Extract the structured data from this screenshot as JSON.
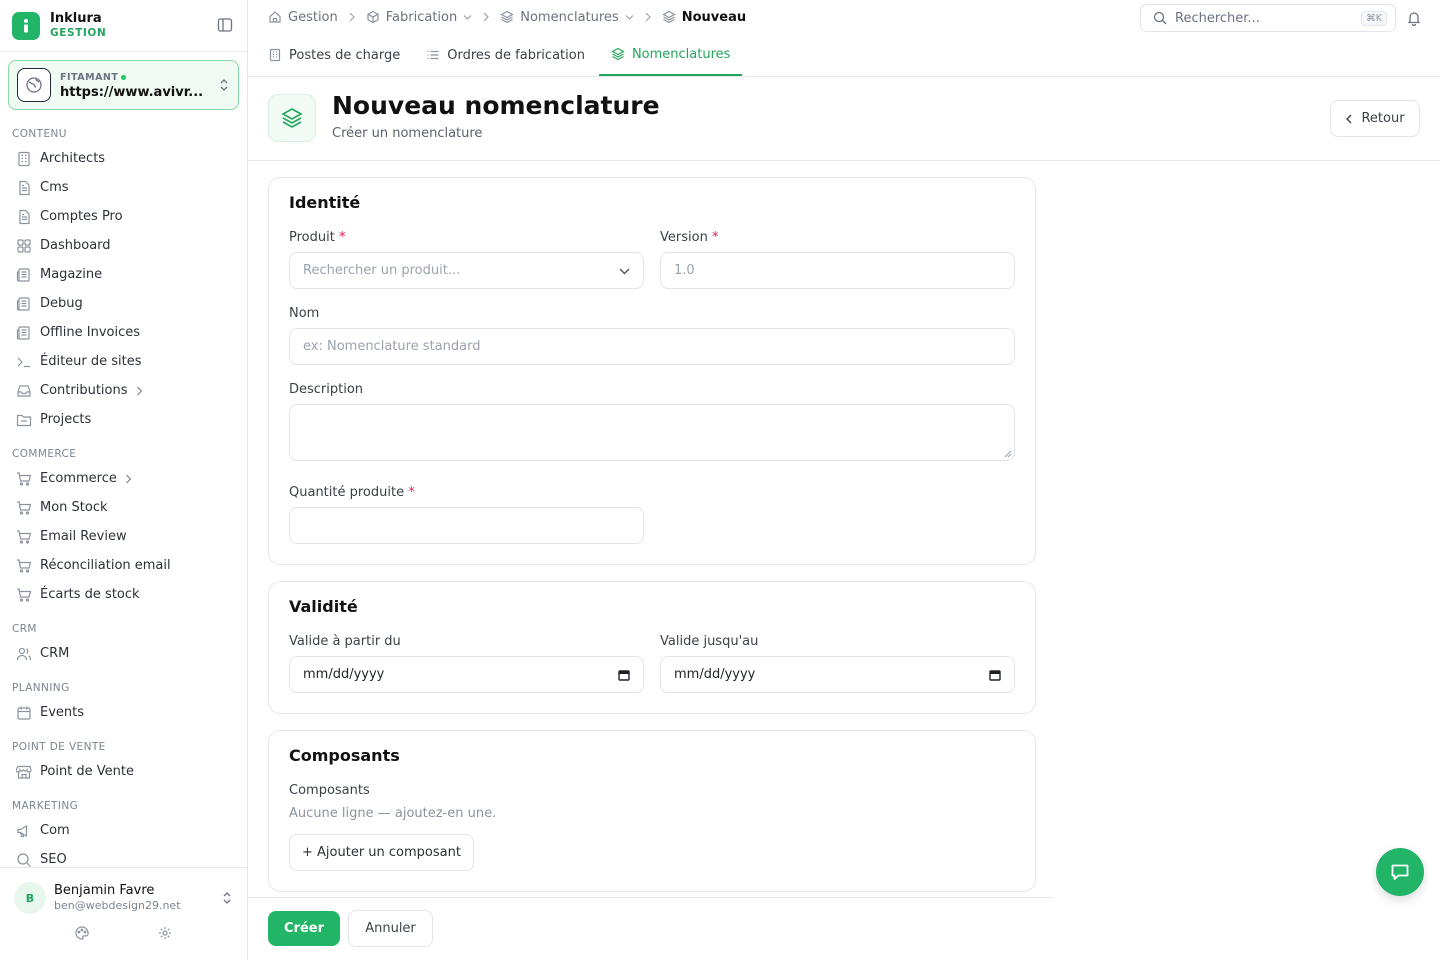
{
  "brand": {
    "name": "Inklura",
    "sub": "GESTION"
  },
  "site": {
    "label": "FITAMANT",
    "url": "https://www.avivr..."
  },
  "sidebar": {
    "sections": [
      {
        "title": "CONTENU",
        "items": [
          {
            "label": "Architects",
            "icon": "building-icon"
          },
          {
            "label": "Cms",
            "icon": "file-icon"
          },
          {
            "label": "Comptes Pro",
            "icon": "file-icon"
          },
          {
            "label": "Dashboard",
            "icon": "grid-icon"
          },
          {
            "label": "Magazine",
            "icon": "newspaper-icon"
          },
          {
            "label": "Debug",
            "icon": "newspaper-icon"
          },
          {
            "label": "Offline Invoices",
            "icon": "newspaper-icon"
          },
          {
            "label": "Éditeur de sites",
            "icon": "terminal-icon"
          },
          {
            "label": "Contributions",
            "icon": "inbox-icon",
            "expandable": true
          },
          {
            "label": "Projects",
            "icon": "folder-icon"
          }
        ]
      },
      {
        "title": "COMMERCE",
        "items": [
          {
            "label": "Ecommerce",
            "icon": "cart-icon",
            "expandable": true
          },
          {
            "label": "Mon Stock",
            "icon": "cart-icon"
          },
          {
            "label": "Email Review",
            "icon": "cart-icon"
          },
          {
            "label": "Réconciliation email",
            "icon": "cart-icon"
          },
          {
            "label": "Écarts de stock",
            "icon": "cart-icon"
          }
        ]
      },
      {
        "title": "CRM",
        "items": [
          {
            "label": "CRM",
            "icon": "users-icon"
          }
        ]
      },
      {
        "title": "PLANNING",
        "items": [
          {
            "label": "Events",
            "icon": "calendar-icon"
          }
        ]
      },
      {
        "title": "POINT DE VENTE",
        "items": [
          {
            "label": "Point de Vente",
            "icon": "store-icon"
          }
        ]
      },
      {
        "title": "MARKETING",
        "items": [
          {
            "label": "Com",
            "icon": "megaphone-icon"
          },
          {
            "label": "SEO",
            "icon": "search-icon"
          }
        ]
      }
    ]
  },
  "user": {
    "initial": "B",
    "name": "Benjamin Favre",
    "email": "ben@webdesign29.net"
  },
  "breadcrumb": {
    "home": "Gestion",
    "fabrication": "Fabrication",
    "nomenclatures": "Nomenclatures",
    "current": "Nouveau"
  },
  "search": {
    "placeholder": "Rechercher...",
    "shortcut": "⌘K"
  },
  "tabs": [
    {
      "label": "Postes de charge"
    },
    {
      "label": "Ordres de fabrication"
    },
    {
      "label": "Nomenclatures",
      "active": true
    }
  ],
  "header": {
    "title": "Nouveau nomenclature",
    "subtitle": "Créer un nomenclature",
    "back": "Retour"
  },
  "identity": {
    "title": "Identité",
    "product_label": "Produit",
    "product_placeholder": "Rechercher un produit...",
    "version_label": "Version",
    "version_placeholder": "1.0",
    "name_label": "Nom",
    "name_placeholder": "ex: Nomenclature standard",
    "description_label": "Description",
    "quantity_label": "Quantité produite",
    "required_mark": "*"
  },
  "validity": {
    "title": "Validité",
    "from_label": "Valide à partir du",
    "to_label": "Valide jusqu'au",
    "date_placeholder": "mm/dd/yyyy"
  },
  "components": {
    "title": "Composants",
    "label": "Composants",
    "empty": "Aucune ligne — ajoutez-en une.",
    "add": "+ Ajouter un composant"
  },
  "actions": {
    "create": "Créer",
    "cancel": "Annuler"
  },
  "colors": {
    "accent": "#22b567",
    "accent_text": "#22a55d",
    "required": "#e11d48"
  }
}
